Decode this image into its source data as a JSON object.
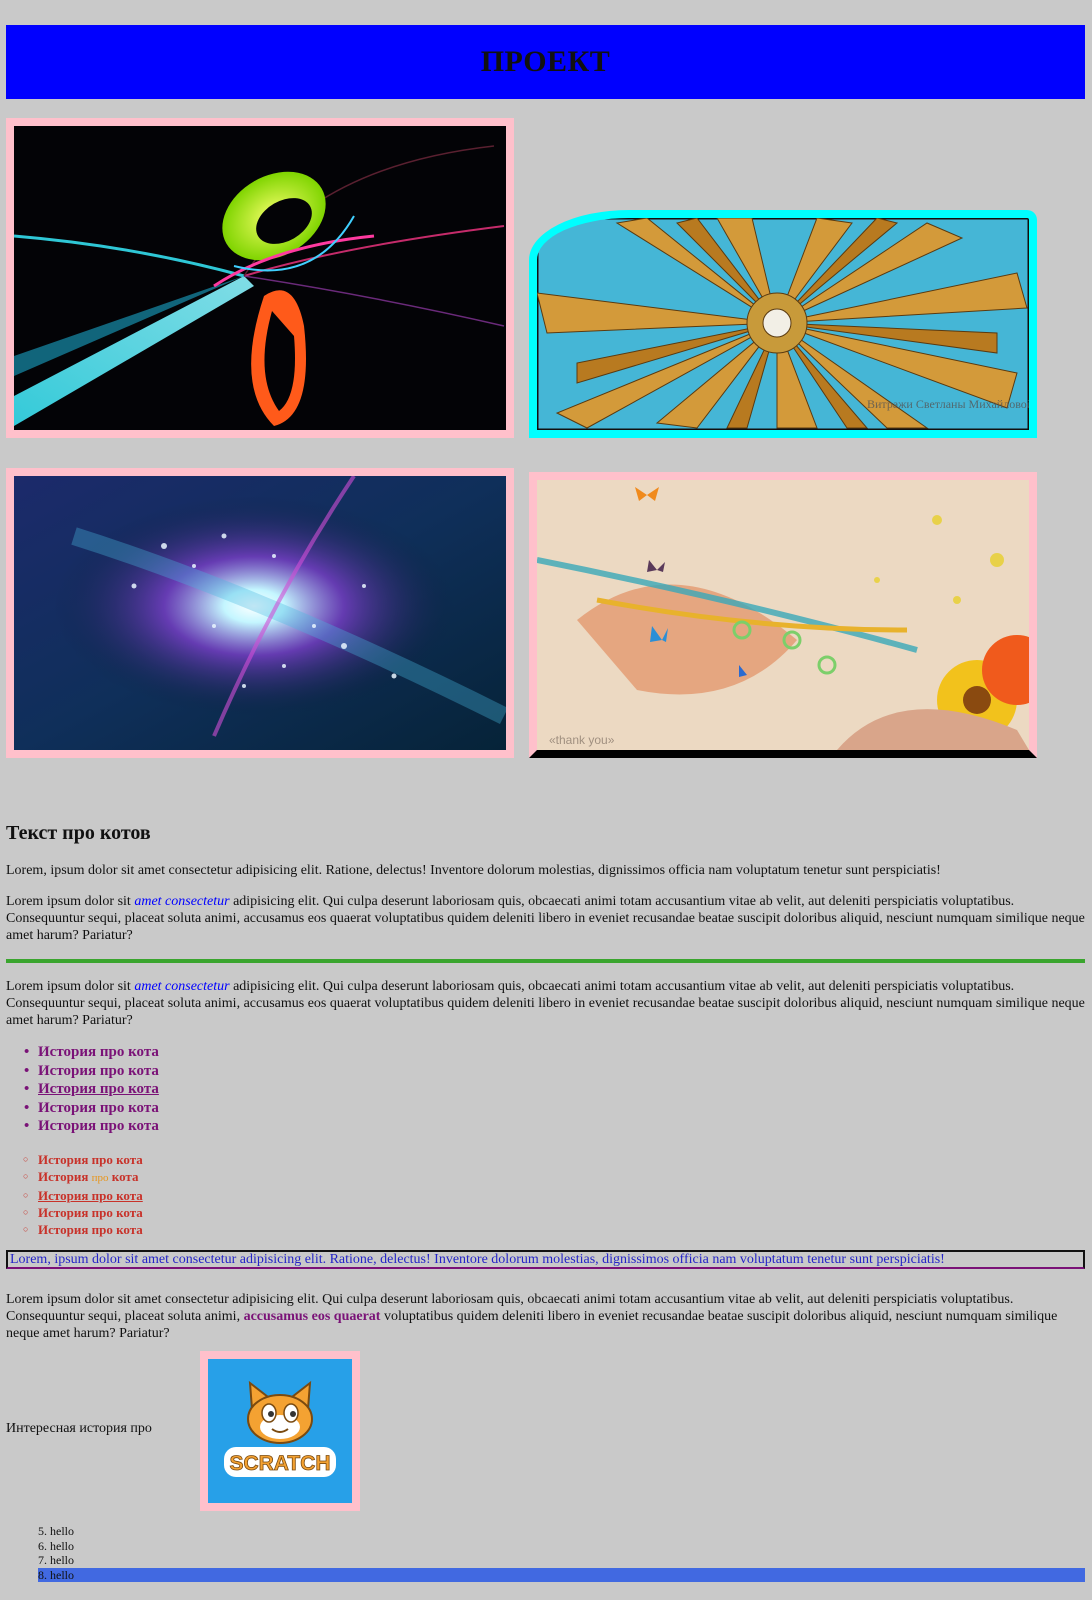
{
  "header": {
    "title": "ПРОЕКТ"
  },
  "section": {
    "title": "Текст про котов"
  },
  "paragraphs": {
    "p1": "Lorem, ipsum dolor sit amet consectetur adipisicing elit. Ratione, delectus! Inventore dolorum molestias, dignissimos officia nam voluptatum tenetur sunt perspiciatis!",
    "p2_before": "Lorem ipsum dolor sit ",
    "p2_em": "amet consectetur",
    "p2_after": " adipisicing elit. Qui culpa deserunt laboriosam quis, obcaecati animi totam accusantium vitae ab velit, aut deleniti perspiciatis voluptatibus. Consequuntur sequi, placeat soluta animi, accusamus eos quaerat voluptatibus quidem deleniti libero in eveniet recusandae beatae suscipit doloribus aliquid, nesciunt numquam similique neque amet harum? Pariatur?",
    "p3_before": "Lorem ipsum dolor sit ",
    "p3_em": "amet consectetur",
    "p3_after": " adipisicing elit. Qui culpa deserunt laboriosam quis, obcaecati animi totam accusantium vitae ab velit, aut deleniti perspiciatis voluptatibus. Consequuntur sequi, placeat soluta animi, accusamus eos quaerat voluptatibus quidem deleniti libero in eveniet recusandae beatae suscipit doloribus aliquid, nesciunt numquam similique neque amet harum? Pariatur?",
    "boxed": "Lorem, ipsum dolor sit amet consectetur adipisicing elit. Ratione, delectus! Inventore dolorum molestias, dignissimos officia nam voluptatum tenetur sunt perspiciatis!",
    "p5_before": "Lorem ipsum dolor sit amet consectetur adipisicing elit. Qui culpa deserunt laboriosam quis, obcaecati animi totam accusantium vitae ab velit, aut deleniti perspiciatis voluptatibus. Consequuntur sequi, placeat soluta animi, ",
    "p5_strong": "accusamus eos quaerat",
    "p5_after": " voluptatibus quidem deleniti libero in eveniet recusandae beatae suscipit doloribus aliquid, nesciunt numquam similique neque amet harum? Pariatur?"
  },
  "list1": [
    "История про кота",
    "История про кота",
    "История про кота",
    "История про кота",
    "История про кота"
  ],
  "list2": {
    "i1": "История про кота",
    "i2_a": "История ",
    "i2_b": "про",
    "i2_c": " кота",
    "i3": "История про кота",
    "i4": "История про кота",
    "i5": "История про кота"
  },
  "side_label": "Интересная история про",
  "scratch_logo": "SCRATCH",
  "image4_caption": "«thank you»",
  "image2_signature": "Витражи Светланы Михайловой",
  "hello_list": [
    "5. hello",
    "6. hello",
    "7. hello",
    "8. hello"
  ],
  "colors": {
    "header_bg": "#0000ff",
    "page_bg": "#c9c9c9",
    "frame_pink": "#ffc0cb",
    "frame_cyan": "#00ffff",
    "rule_green": "#3aa52e",
    "highlight": "#4169e1"
  }
}
